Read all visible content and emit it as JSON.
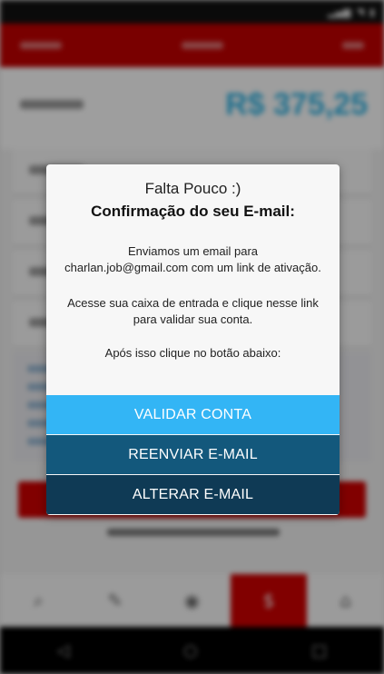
{
  "background": {
    "amount": "R$ 375,25"
  },
  "dialog": {
    "title": "Falta Pouco :)",
    "subtitle": "Confirmação do seu E-mail:",
    "sent_prefix": "Enviamos um email para",
    "email": "charlan.job@gmail.com",
    "sent_suffix": " com um link de ativação.",
    "instructions": "Acesse sua caixa de entrada e clique nesse link para validar sua conta.",
    "after": "Após isso clique no botão abaixo:",
    "buttons": {
      "validate": "VALIDAR CONTA",
      "resend": "REENVIAR E-MAIL",
      "change": "ALTERAR E-MAIL"
    }
  },
  "colors": {
    "validate_button": "#33b5f5",
    "resend_button": "#13587c",
    "change_button": "#0f3a55",
    "app_red": "#c40000"
  },
  "icons": {
    "status": [
      "signal-icon",
      "wifi-icon",
      "battery-icon"
    ],
    "bottom_nav": [
      "search-icon",
      "tag-icon",
      "eye-icon",
      "price-icon",
      "home-icon"
    ],
    "system_nav": [
      "back-icon",
      "home-circle-icon",
      "recents-icon"
    ]
  }
}
